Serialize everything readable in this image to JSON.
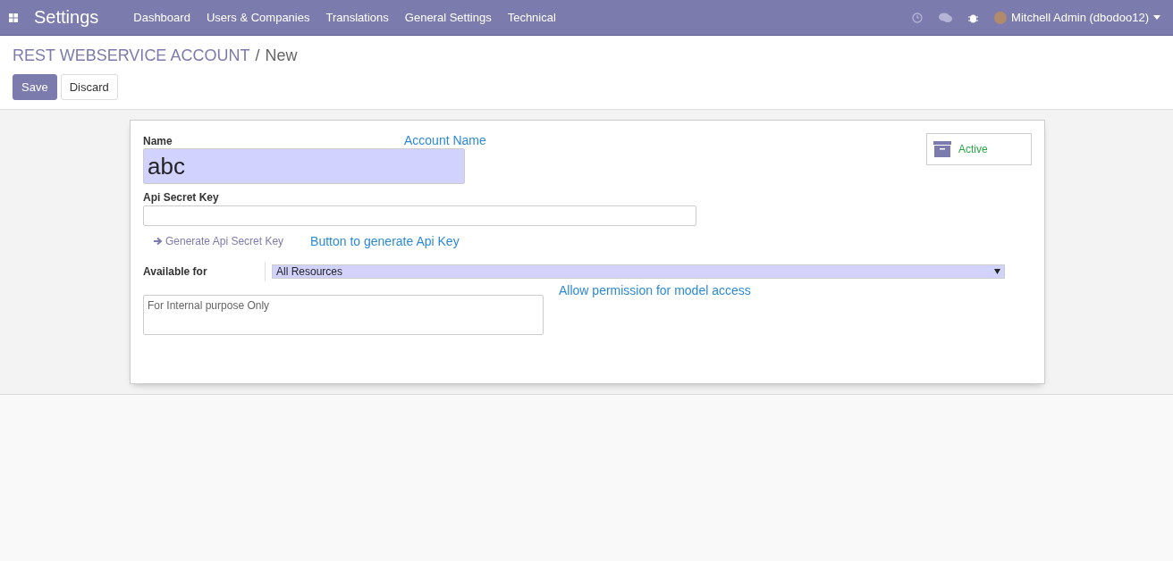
{
  "navbar": {
    "app_title": "Settings",
    "menu": [
      "Dashboard",
      "Users & Companies",
      "Translations",
      "General Settings",
      "Technical"
    ],
    "user": "Mitchell Admin (dbodoo12)"
  },
  "breadcrumb": {
    "parent": "REST WEBSERVICE ACCOUNT",
    "separator": "/",
    "current": "New"
  },
  "buttons": [
    {
      "label": "Save",
      "kind": "primary"
    },
    {
      "label": "Discard",
      "kind": "secondary"
    }
  ],
  "form": {
    "active_toggle": {
      "label": "Active",
      "active": true
    },
    "name": {
      "label": "Name",
      "value": "abc",
      "note": "Account Name"
    },
    "api_key": {
      "label": "Api Secret Key",
      "button": "Generate Api Secret Key",
      "note": "Button to generate Api Key"
    },
    "available_for": {
      "label": "Available for",
      "value": "All Resources"
    },
    "description": {
      "placeholder": "For Internal purpose Only",
      "note": "Allow permission for model access"
    }
  }
}
